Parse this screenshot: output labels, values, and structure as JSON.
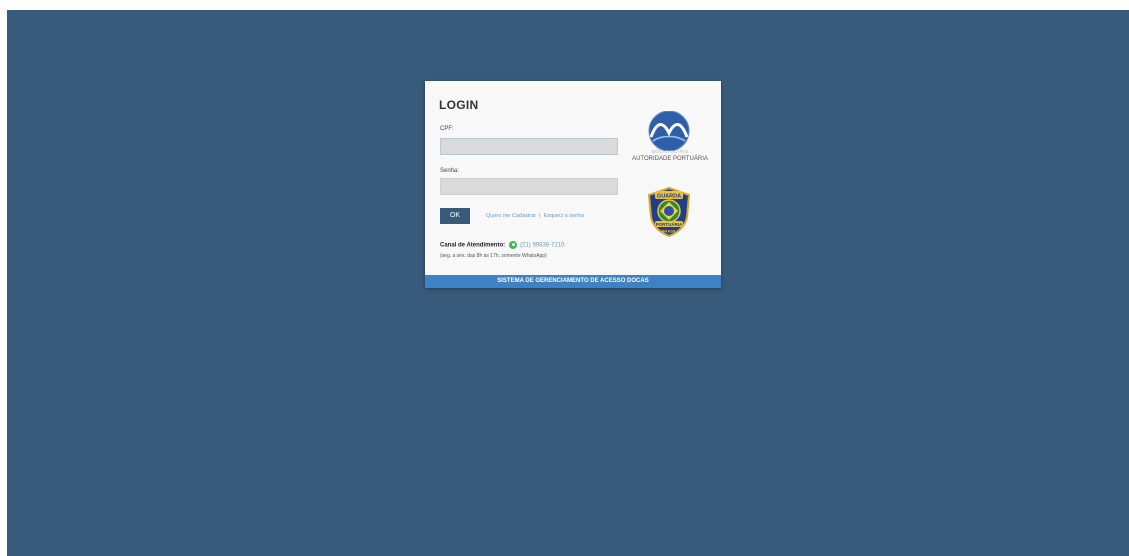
{
  "login": {
    "title": "LOGIN",
    "cpf_label": "CPF:",
    "cpf_value": "",
    "senha_label": "Senha:",
    "senha_value": "",
    "ok_label": "OK",
    "register_link": "Quero me Cadastrar",
    "separator": "|",
    "forgot_link": "Esqueci a senha",
    "canal_label": "Canal de Atendimento:",
    "phone": "(21) 99836-7210",
    "hours": "(seg. a sex. das 8h às 17h, somente WhatsApp)",
    "footer": "SISTEMA DE GERENCIAMENTO DE ACESSO DOCAS"
  },
  "logos": {
    "docas_sub": "DOCAS DO RIO",
    "docas_main": "AUTORIDADE PORTUÁRIA",
    "badge_top": "GUARDA",
    "badge_bottom": "PORTUÁRIA",
    "badge_country": "BRASIL"
  },
  "icons": {
    "whatsapp": "whatsapp-icon"
  },
  "colors": {
    "background": "#385b7c",
    "ok_button": "#385b7c",
    "footer": "#3d82c4",
    "link": "#6a9cc8",
    "whatsapp": "#3cba54"
  }
}
